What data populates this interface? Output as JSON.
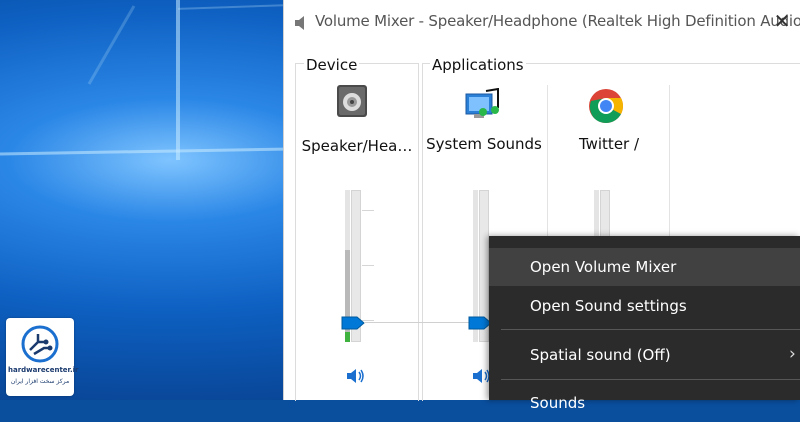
{
  "window": {
    "title": "Volume Mixer - Speaker/Headphone (Realtek High Definition Audio)",
    "close_glyph": "✕"
  },
  "groups": {
    "device_label": "Device",
    "applications_label": "Applications"
  },
  "channels": [
    {
      "name": "Speaker/Hea…",
      "icon": "speaker-device-icon",
      "volume": 0.12,
      "peak": 0.05
    },
    {
      "name": "System Sounds",
      "icon": "system-sounds-icon",
      "volume": 0.12,
      "peak": 0
    },
    {
      "name": "Twitter /",
      "icon": "chrome-icon",
      "volume": null,
      "peak": 0
    }
  ],
  "context_menu": {
    "items": [
      {
        "label": "Open Volume Mixer",
        "highlighted": true
      },
      {
        "label": "Open Sound settings",
        "highlighted": false
      },
      {
        "label": "Spatial sound (Off)",
        "highlighted": false,
        "has_submenu": true
      },
      {
        "label": "Sounds",
        "highlighted": false
      }
    ]
  },
  "watermark": {
    "brand": "hardwarecenter.ir",
    "subtitle": "مرکز سخت افزار ایران"
  },
  "colors": {
    "accent": "#0078d7",
    "menu_bg": "#2b2b2b",
    "menu_hover": "#414141",
    "meter_green": "#3fb13f"
  }
}
